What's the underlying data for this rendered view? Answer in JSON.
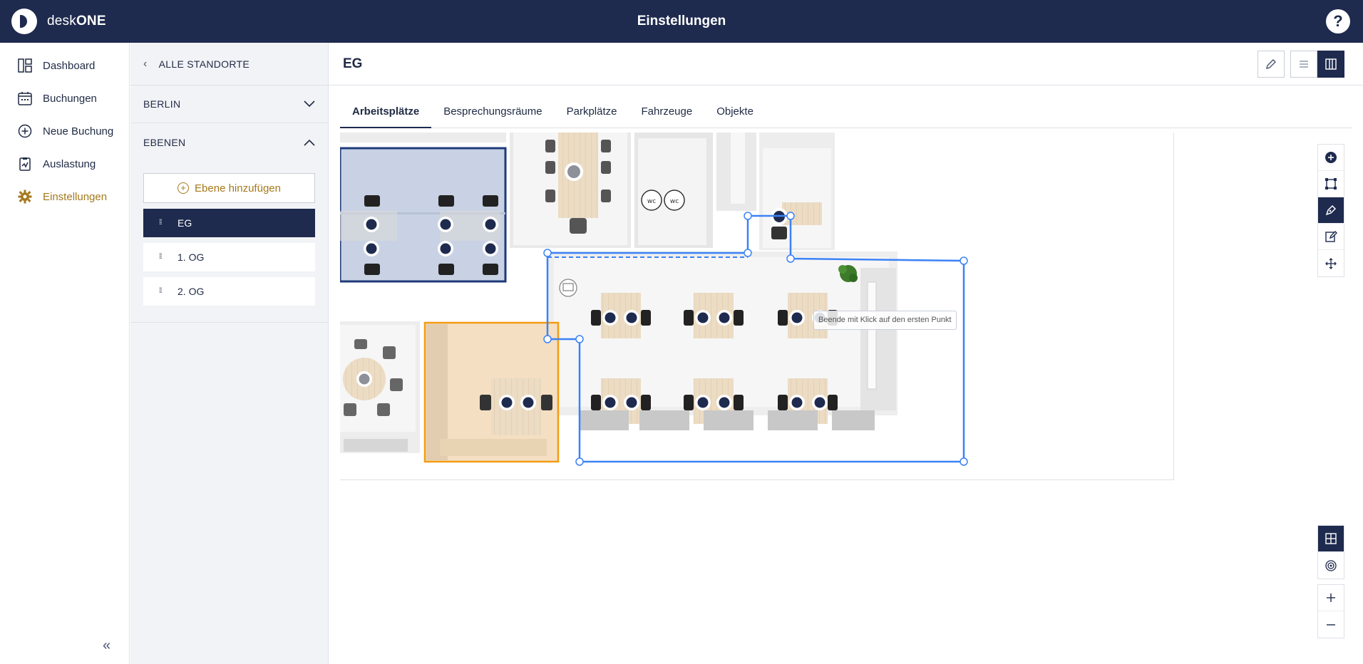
{
  "app": {
    "brand_light": "desk",
    "brand_bold": "ONE",
    "title": "Einstellungen",
    "help": "?"
  },
  "nav": {
    "items": [
      {
        "label": "Dashboard",
        "icon": "dashboard-icon"
      },
      {
        "label": "Buchungen",
        "icon": "calendar-icon"
      },
      {
        "label": "Neue Buchung",
        "icon": "plus-circle-icon"
      },
      {
        "label": "Auslastung",
        "icon": "clipboard-chart-icon"
      },
      {
        "label": "Einstellungen",
        "icon": "gear-icon",
        "active": true
      }
    ]
  },
  "panel": {
    "back_label": "ALLE STANDORTE",
    "location": "BERLIN",
    "levels_header": "EBENEN",
    "add_level": "Ebene hinzufügen",
    "levels": [
      "EG",
      "1. OG",
      "2. OG"
    ]
  },
  "main": {
    "title": "EG",
    "tabs": [
      "Arbeitsplätze",
      "Besprechungsräume",
      "Parkplätze",
      "Fahrzeuge",
      "Objekte"
    ],
    "tooltip": "Beende mit Klick auf den ersten Punkt"
  },
  "colors": {
    "primary": "#1e2a4e",
    "accent": "#a4791c",
    "selection": "#3b82f6",
    "highlight": "#f39c12"
  }
}
